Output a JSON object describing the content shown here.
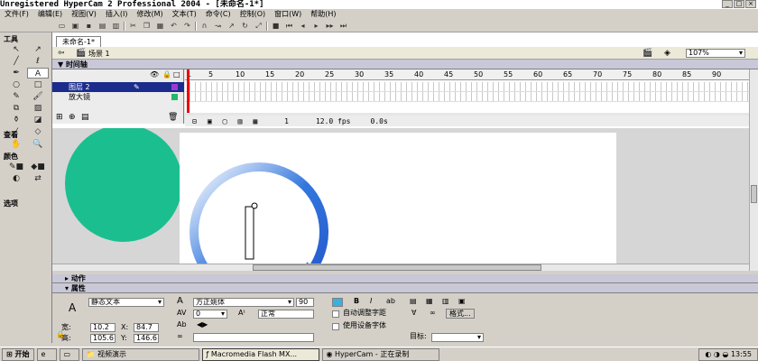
{
  "window": {
    "title": "Unregistered HyperCam 2 Professional 2004 - [未命名-1*]"
  },
  "menu": [
    "文件(F)",
    "编辑(E)",
    "视图(V)",
    "插入(I)",
    "修改(M)",
    "文本(T)",
    "命令(C)",
    "控制(O)",
    "窗口(W)",
    "帮助(H)"
  ],
  "tools_panel": {
    "title": "工具",
    "view_label": "查看",
    "colors_label": "颜色",
    "options_label": "选项"
  },
  "document": {
    "tab": "未命名-1*",
    "scene": "场景 1",
    "zoom": "107%"
  },
  "timeline": {
    "header": "时间轴",
    "layers": [
      {
        "name": "图层 2",
        "selected": true
      },
      {
        "name": "放大镜",
        "selected": false
      }
    ],
    "ruler": [
      "1",
      "5",
      "10",
      "15",
      "20",
      "25",
      "30",
      "35",
      "40",
      "45",
      "50",
      "55",
      "60",
      "65",
      "70",
      "75",
      "80",
      "85",
      "90"
    ],
    "current_frame": "1",
    "fps": "12.0 fps",
    "elapsed": "0.0s"
  },
  "colors": {
    "circle": "#1bbf8f",
    "ring": "#3377dd",
    "selected_layer": "#1c2c8c"
  },
  "panels": {
    "actions": "动作",
    "properties": "属性"
  },
  "properties": {
    "text_type": "静态文本",
    "font": "方正姚体",
    "font_size": "90",
    "char_spacing": "0",
    "char_position": "正常",
    "auto_kern": "自动调整字距",
    "device_fonts": "使用设备字体",
    "format_button": "格式...",
    "width_label": "宽:",
    "width": "10.2",
    "height_label": "高:",
    "height": "105.6",
    "x_label": "X:",
    "x": "84.7",
    "y_label": "Y:",
    "y": "146.6",
    "target_label": "目标:"
  },
  "taskbar": {
    "start": "开始",
    "items": [
      {
        "label": "视频演示",
        "active": false
      },
      {
        "label": "Macromedia Flash MX...",
        "active": true
      },
      {
        "label": "HyperCam - 正在录制",
        "active": false
      }
    ],
    "clock": "13:55"
  }
}
